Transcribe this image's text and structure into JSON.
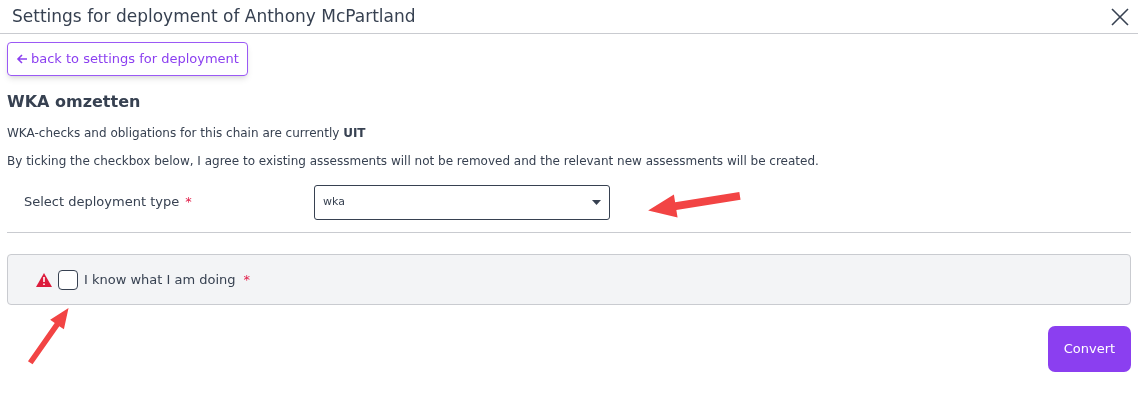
{
  "dialog": {
    "title": "Settings for deployment of Anthony McPartland"
  },
  "back_link": {
    "label": "back to settings for deployment"
  },
  "heading": "WKA omzetten",
  "paragraphs": [
    "WKA-checks and obligations for this chain are currently **UIT**",
    "By ticking the checkbox below, I agree to existing assessments will not be removed and the relevant new assessments will be created."
  ],
  "deployment_type": {
    "label": "Select deployment type",
    "required_mark": "*",
    "value": "wka"
  },
  "confirm": {
    "label": "I know what I am doing",
    "required_mark": "*",
    "checked": false,
    "warning": true
  },
  "buttons": [
    {
      "label": "Convert"
    }
  ]
}
